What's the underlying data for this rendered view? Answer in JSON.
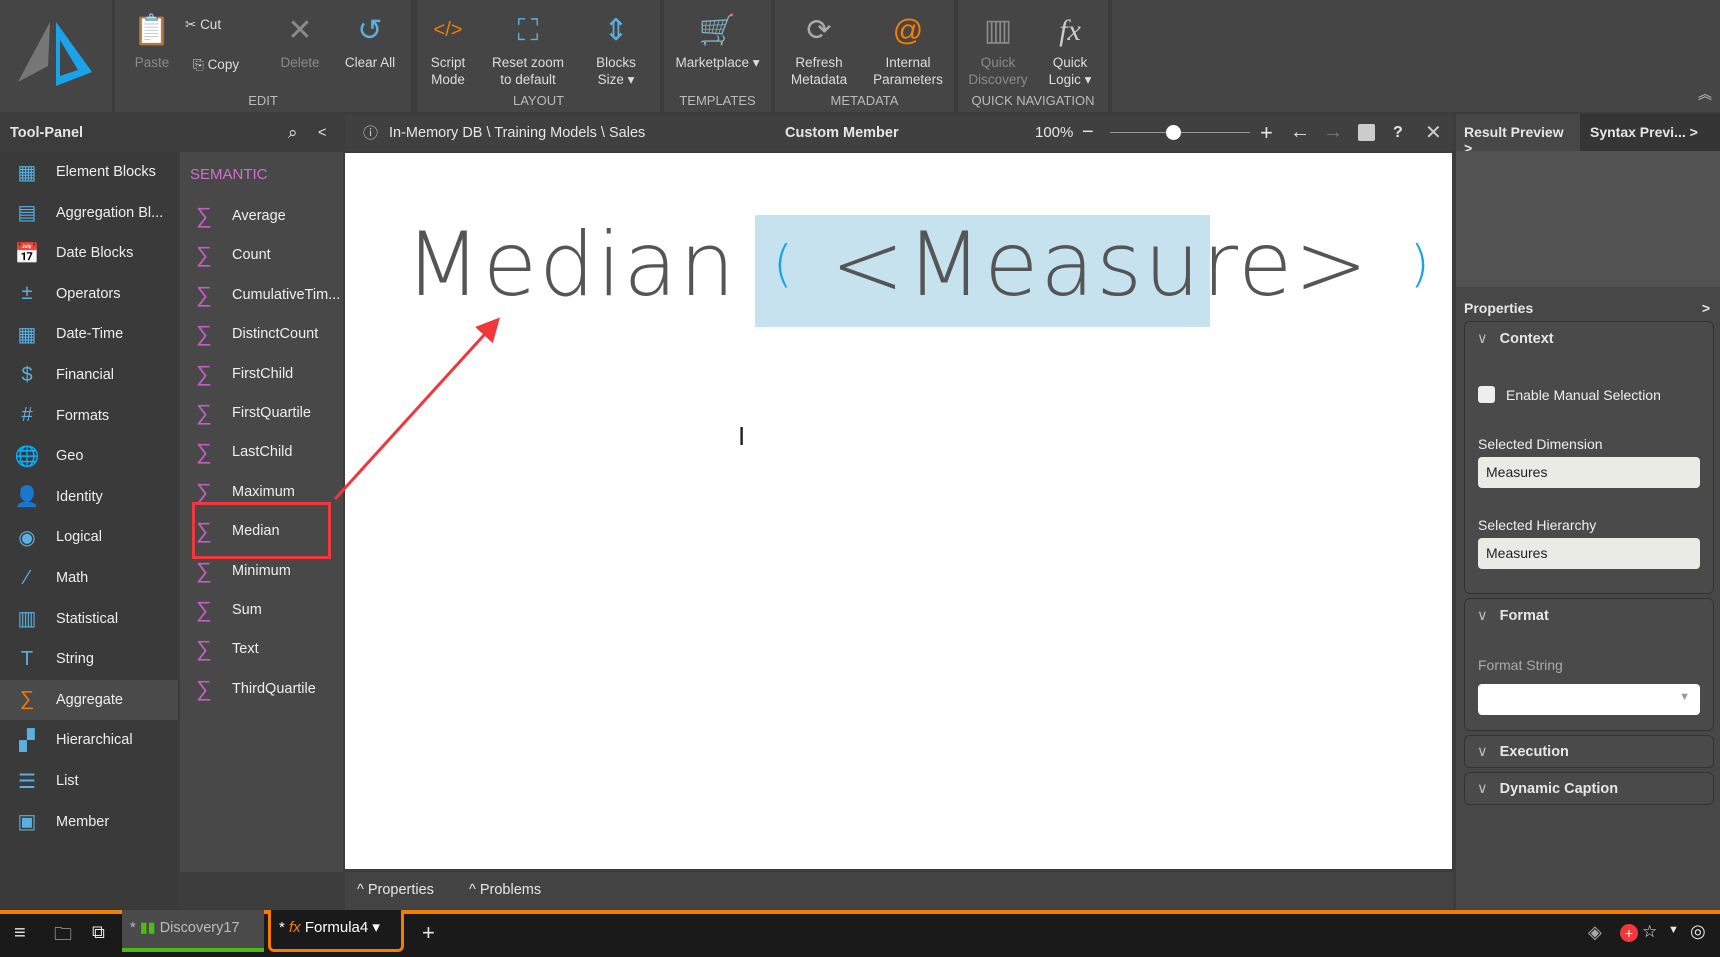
{
  "toolbar": {
    "edit": {
      "group": "EDIT",
      "paste": "Paste",
      "cut": "Cut",
      "copy": "Copy",
      "delete": "Delete",
      "clear_all": "Clear All"
    },
    "layout": {
      "group": "LAYOUT",
      "script_mode": [
        "Script",
        "Mode"
      ],
      "reset_zoom": [
        "Reset zoom",
        "to default"
      ],
      "blocks_size": [
        "Blocks",
        "Size ▾"
      ]
    },
    "templates": {
      "group": "TEMPLATES",
      "marketplace": "Marketplace ▾"
    },
    "metadata": {
      "group": "METADATA",
      "refresh": [
        "Refresh",
        "Metadata"
      ],
      "internal": [
        "Internal",
        "Parameters"
      ]
    },
    "quick_nav": {
      "group": "QUICK NAVIGATION",
      "discovery": [
        "Quick",
        "Discovery"
      ],
      "logic": [
        "Quick",
        "Logic ▾"
      ]
    }
  },
  "tool_panel": {
    "title": "Tool-Panel",
    "items": [
      "Element Blocks",
      "Aggregation Bl...",
      "Date Blocks",
      "Operators",
      "Date-Time",
      "Financial",
      "Formats",
      "Geo",
      "Identity",
      "Logical",
      "Math",
      "Statistical",
      "String",
      "Aggregate",
      "Hierarchical",
      "List",
      "Member"
    ],
    "selected": "Aggregate",
    "semantic_header": "SEMANTIC",
    "semantic_items": [
      "Average",
      "Count",
      "CumulativeTim...",
      "DistinctCount",
      "FirstChild",
      "FirstQuartile",
      "LastChild",
      "Maximum",
      "Median",
      "Minimum",
      "Sum",
      "Text",
      "ThirdQuartile"
    ]
  },
  "editor": {
    "breadcrumb": "In-Memory DB \\ Training Models \\ Sales",
    "title": "Custom Member",
    "zoom": "100%",
    "zoom_slider_fraction": 0.45,
    "formula_function": "Median",
    "formula_open": "(",
    "formula_arg": "<Measure>",
    "formula_close": ")"
  },
  "bottom_tabs": {
    "properties": "Properties",
    "problems": "Problems"
  },
  "right": {
    "result_preview": "Result Preview",
    "syntax_preview": "Syntax Previ...",
    "properties": "Properties",
    "context": "Context",
    "enable_manual": "Enable Manual Selection",
    "sel_dim_label": "Selected Dimension",
    "sel_dim": "Measures",
    "sel_hier_label": "Selected Hierarchy",
    "sel_hier": "Measures",
    "format": "Format",
    "format_string": "Format String",
    "execution": "Execution",
    "dynamic_caption": "Dynamic Caption"
  },
  "taskbar": {
    "tab1": "Discovery17",
    "tab1_mod": "*",
    "tab2": "Formula4",
    "tab2_mod": "*"
  },
  "colors": {
    "accent": "#f57c00",
    "blue": "#1aa3e8",
    "highlight": "#c5e2ee",
    "red": "#f0383c",
    "green": "#4cbb17"
  }
}
